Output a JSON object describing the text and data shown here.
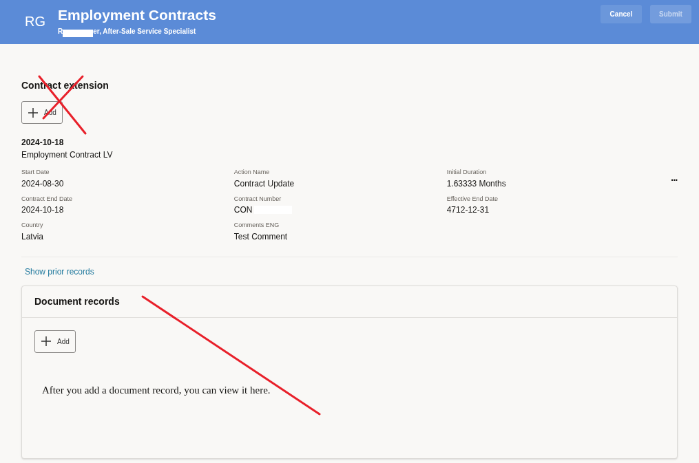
{
  "header": {
    "initials": "RG",
    "title": "Employment Contracts",
    "subtitle_start": "R",
    "subtitle_end": "er, After-Sale Service Specialist",
    "buttons": [
      {
        "label": "Cancel",
        "disabled": false
      },
      {
        "label": "Submit",
        "disabled": true
      }
    ]
  },
  "contract_extension": {
    "title": "Contract extension",
    "add_label": "Add",
    "record": {
      "date": "2024-10-18",
      "name": "Employment Contract LV",
      "fields": [
        {
          "label": "Start Date",
          "value": "2024-08-30"
        },
        {
          "label": "Action Name",
          "value": "Contract Update"
        },
        {
          "label": "Initial Duration",
          "value": "1.63333 Months"
        },
        {
          "label": "Contract End Date",
          "value": "2024-10-18"
        },
        {
          "label": "Contract Number",
          "value": "CON"
        },
        {
          "label": "Effective End Date",
          "value": "4712-12-31"
        },
        {
          "label": "Country",
          "value": "Latvia"
        },
        {
          "label": "Comments ENG",
          "value": "Test Comment"
        }
      ]
    },
    "more": "•••",
    "link": "Show prior records"
  },
  "document_records": {
    "title": "Document records",
    "add_label": "Add",
    "empty_message": "After you add a document record, you can view it here."
  }
}
